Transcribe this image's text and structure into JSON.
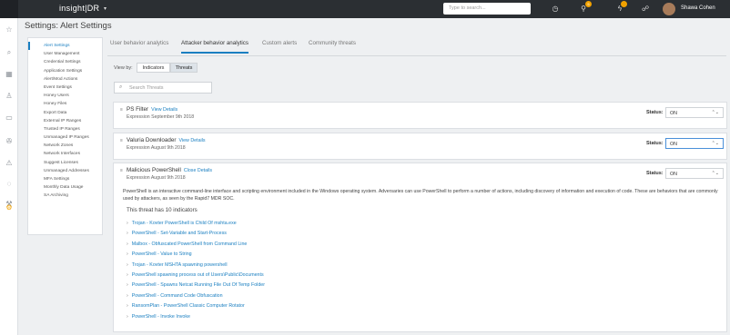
{
  "topbar": {
    "logo": "insight|DR",
    "search_placeholder": "Type to search...",
    "badge_count": "5",
    "user_name": "Shawa Cohen"
  },
  "page_title": "Settings: Alert Settings",
  "menu": {
    "items": [
      "Alert Settings",
      "User Management",
      "Credential Settings",
      "Application Settings",
      "Alert/Mod Actions",
      "Event Settings",
      "Honey Users",
      "Honey Files",
      "Export Data",
      "External IP Ranges",
      "Trusted IP Ranges",
      "Unmanaged IP Ranges",
      "Network Zones",
      "Network Interfaces",
      "Suggest Licenses",
      "Unmanaged Addresses",
      "MFA Settings",
      "Monthly Data Usage",
      "SA Archiving"
    ]
  },
  "tabs": [
    "User behavior analytics",
    "Attacker behavior analytics",
    "Custom alerts",
    "Community threats"
  ],
  "view_by": {
    "label": "View by:",
    "options": [
      "Indicators",
      "Threats"
    ],
    "selected": "Threats"
  },
  "search_placeholder": "Search Threats",
  "status_label": "Status:",
  "threats": [
    {
      "name": "PS Filter",
      "link": "View Details",
      "expression": "Expression September 9th 2018",
      "status": "ON"
    },
    {
      "name": "Valuria Downloader",
      "link": "View Details",
      "expression": "Expression August 9th 2018",
      "status": "ON"
    },
    {
      "name": "Malicious PowerShell",
      "link": "Close Details",
      "expression": "Expression August 9th 2018",
      "status": "ON",
      "description": "PowerShell is an interactive command-line interface and scripting environment included in the Windows operating system. Adversaries can use PowerShell to perform a number of actions, including discovery of information and execution of code. These are behaviors that are commonly used by attackers, as seen by the Rapid7 MDR SOC.",
      "indicator_heading": "This threat has 10 indicators",
      "indicators": [
        "Trojan - Kovter PowerShell is Child Of mshta.exe",
        "PowerShell - Set-Variable and Start-Process",
        "Malbox - Obfuscated PowerShell from Command Line",
        "PowerShell - Value to String",
        "Trojan - Kovter MSHTA spawning powershell",
        "PowerShell spawning process out of Users\\Public\\Documents",
        "PowerShell - Spawns Netcat Running File Out Of Temp Folder",
        "PowerShell - Command Code Obfuscation",
        "RansomPlan - PowerShell Classic Computer Rotator",
        "PowerShell - Invoke Invoke"
      ]
    }
  ]
}
